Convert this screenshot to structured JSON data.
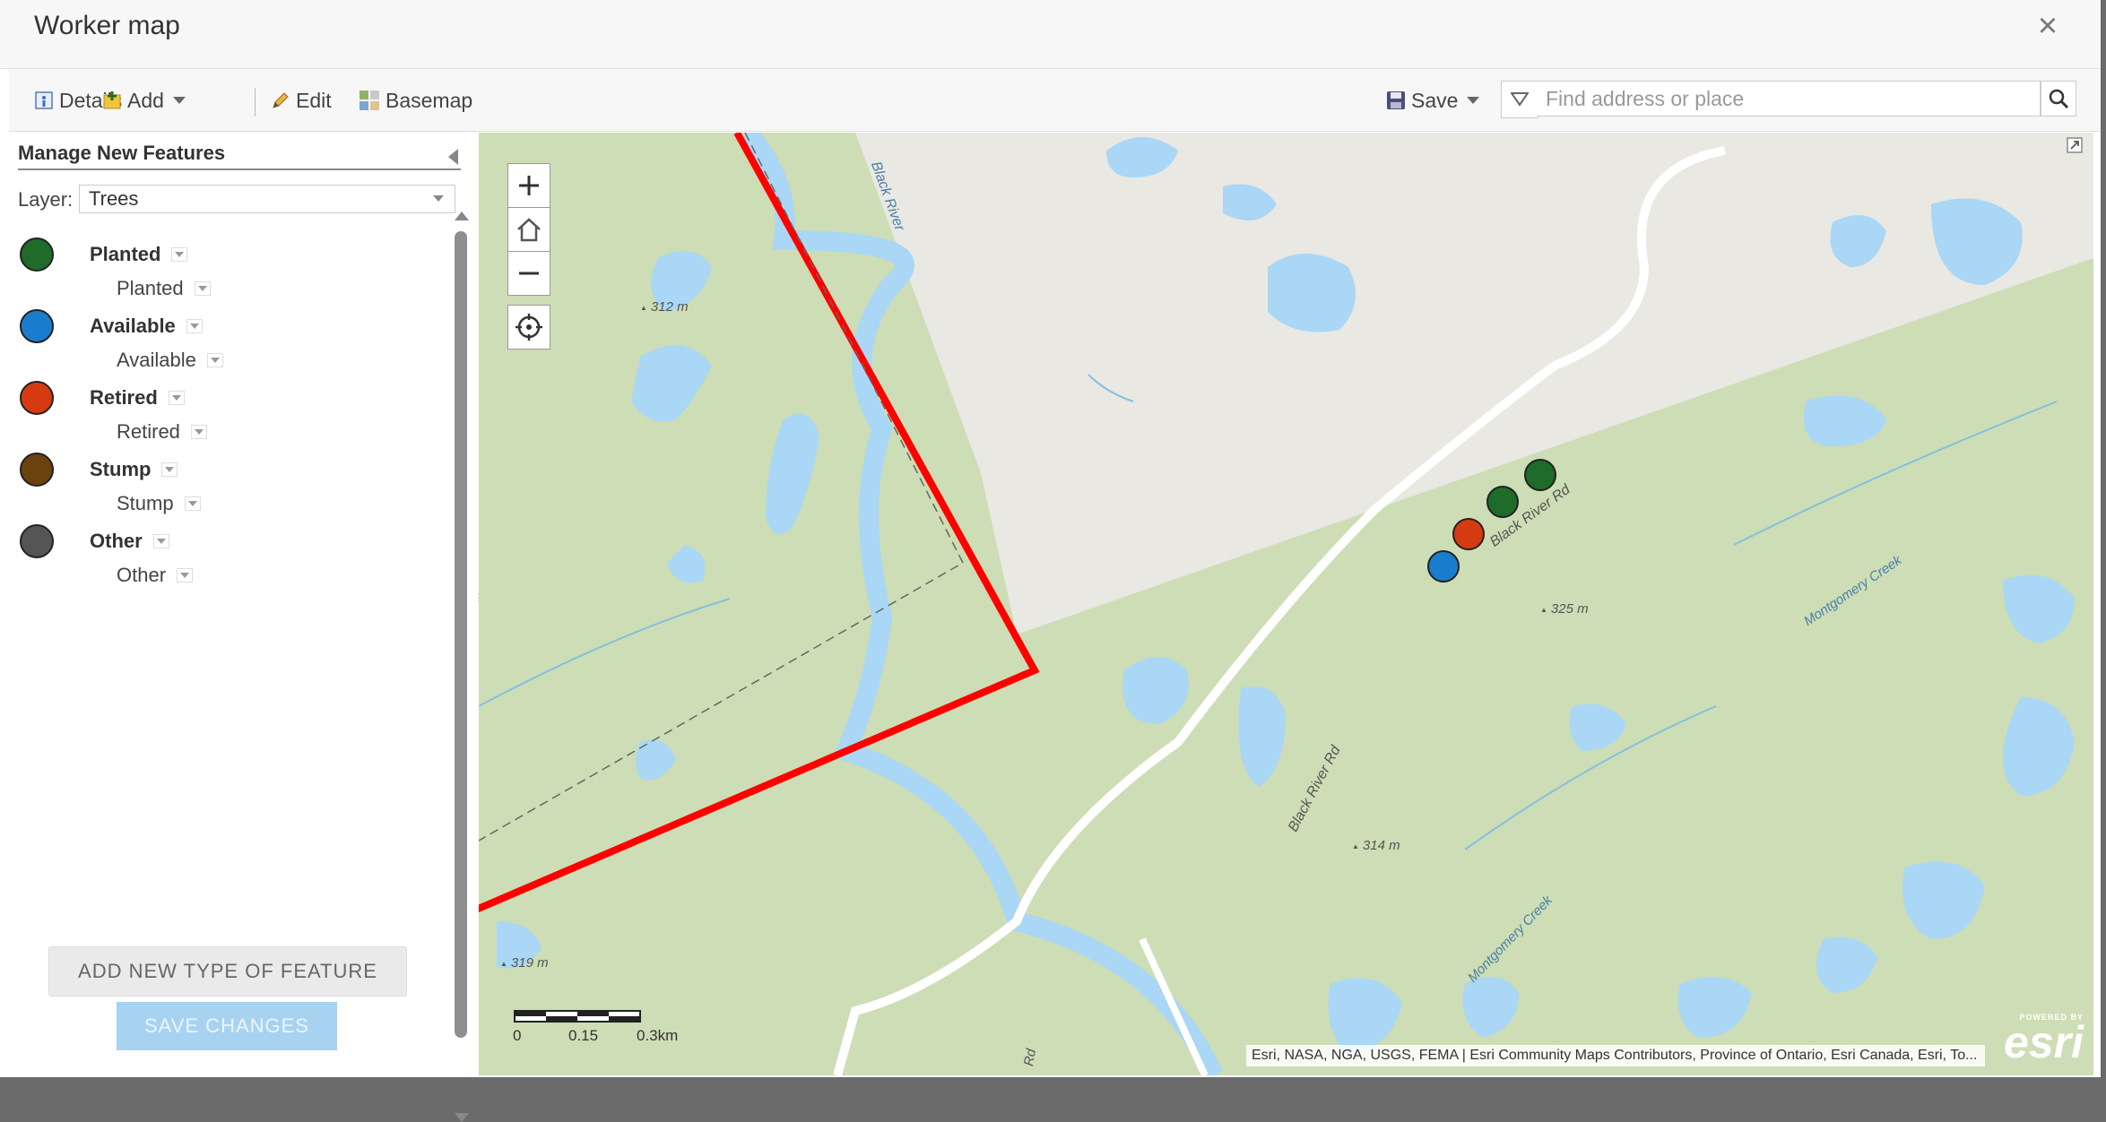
{
  "dialog": {
    "title": "Worker map",
    "close_glyph": "×"
  },
  "toolbar": {
    "details": "Details",
    "add": "Add",
    "edit": "Edit",
    "basemap": "Basemap",
    "save": "Save",
    "search_placeholder": "Find address or place"
  },
  "panel": {
    "title": "Manage New Features",
    "layer_label": "Layer:",
    "layer_value": "Trees",
    "features": [
      {
        "name": "Planted",
        "sub": "Planted",
        "color": "#1e6b2a"
      },
      {
        "name": "Available",
        "sub": "Available",
        "color": "#1a7ccc"
      },
      {
        "name": "Retired",
        "sub": "Retired",
        "color": "#d63a10"
      },
      {
        "name": "Stump",
        "sub": "Stump",
        "color": "#6b420e"
      },
      {
        "name": "Other",
        "sub": "Other",
        "color": "#555555"
      }
    ],
    "add_type_button": "ADD NEW TYPE OF FEATURE",
    "save_changes_button": "SAVE CHANGES"
  },
  "map": {
    "labels": {
      "black_river": "Black River",
      "black_river_rd_1": "Black River Rd",
      "black_river_rd_2": "Black River Rd",
      "montgomery_creek_1": "Montgomery Creek",
      "montgomery_creek_2": "Montgomery Creek",
      "rd_bottom": "Rd"
    },
    "spot_heights": {
      "a": "312 m",
      "b": "325 m",
      "c": "314 m",
      "d": "319 m"
    },
    "scale": {
      "l0": "0",
      "l1": "0.15",
      "l2": "0.3km"
    },
    "attribution": "Esri, NASA, NGA, USGS, FEMA | Esri Community Maps Contributors, Province of Ontario, Esri Canada, Esri, To...",
    "logo": {
      "powered": "POWERED BY",
      "word": "esri"
    },
    "colors": {
      "boundary": "#ff0000",
      "water": "#a9d7f5",
      "green": "#cdddb5"
    }
  }
}
